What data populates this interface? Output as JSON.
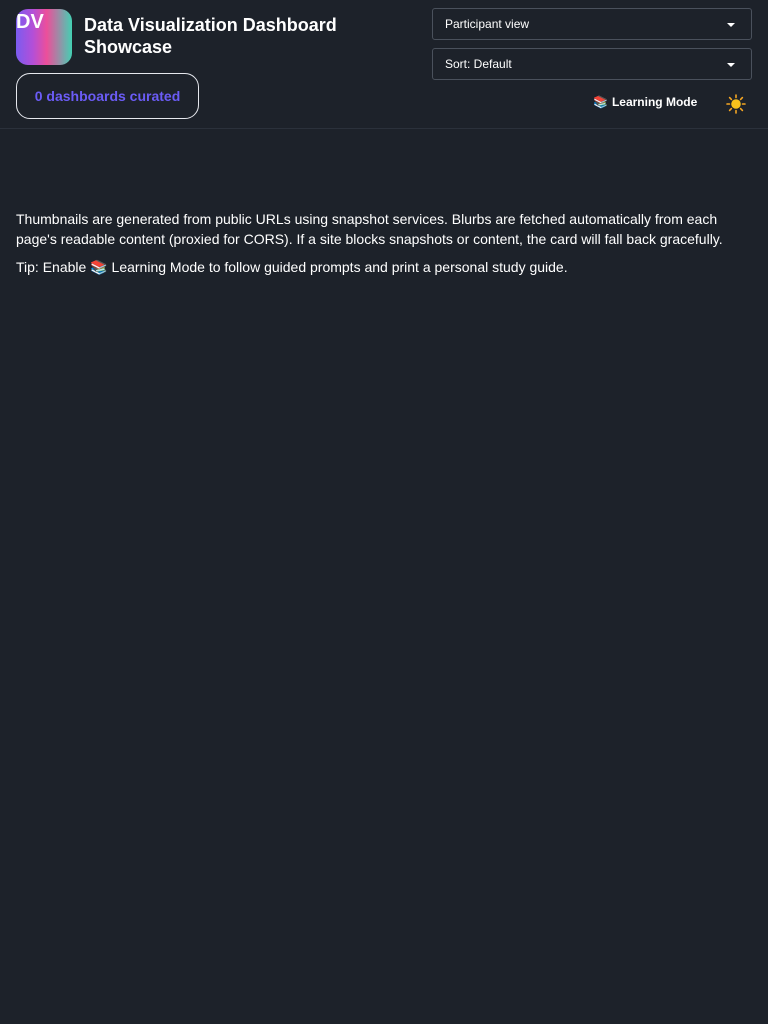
{
  "header": {
    "logo_text": "DV",
    "title": "Data Visualization Dashboard Showcase",
    "count_label": "0 dashboards curated",
    "view_select": {
      "value": "Participant view"
    },
    "sort_select": {
      "value": "Sort: Default"
    },
    "learning_mode": {
      "icon": "📚",
      "label": "Learning Mode"
    },
    "theme_toggle_icon": "sun-icon"
  },
  "main": {
    "info_text": "Thumbnails are generated from public URLs using snapshot services. Blurbs are fetched automatically from each page's readable content (proxied for CORS). If a site blocks snapshots or content, the card will fall back gracefully.",
    "tip_prefix": "Tip: Enable ",
    "tip_icon": "📚",
    "tip_suffix": " Learning Mode to follow guided prompts and print a personal study guide."
  },
  "colors": {
    "background": "#1d222a",
    "accent": "#6b5cf6",
    "text": "#ffffff"
  }
}
